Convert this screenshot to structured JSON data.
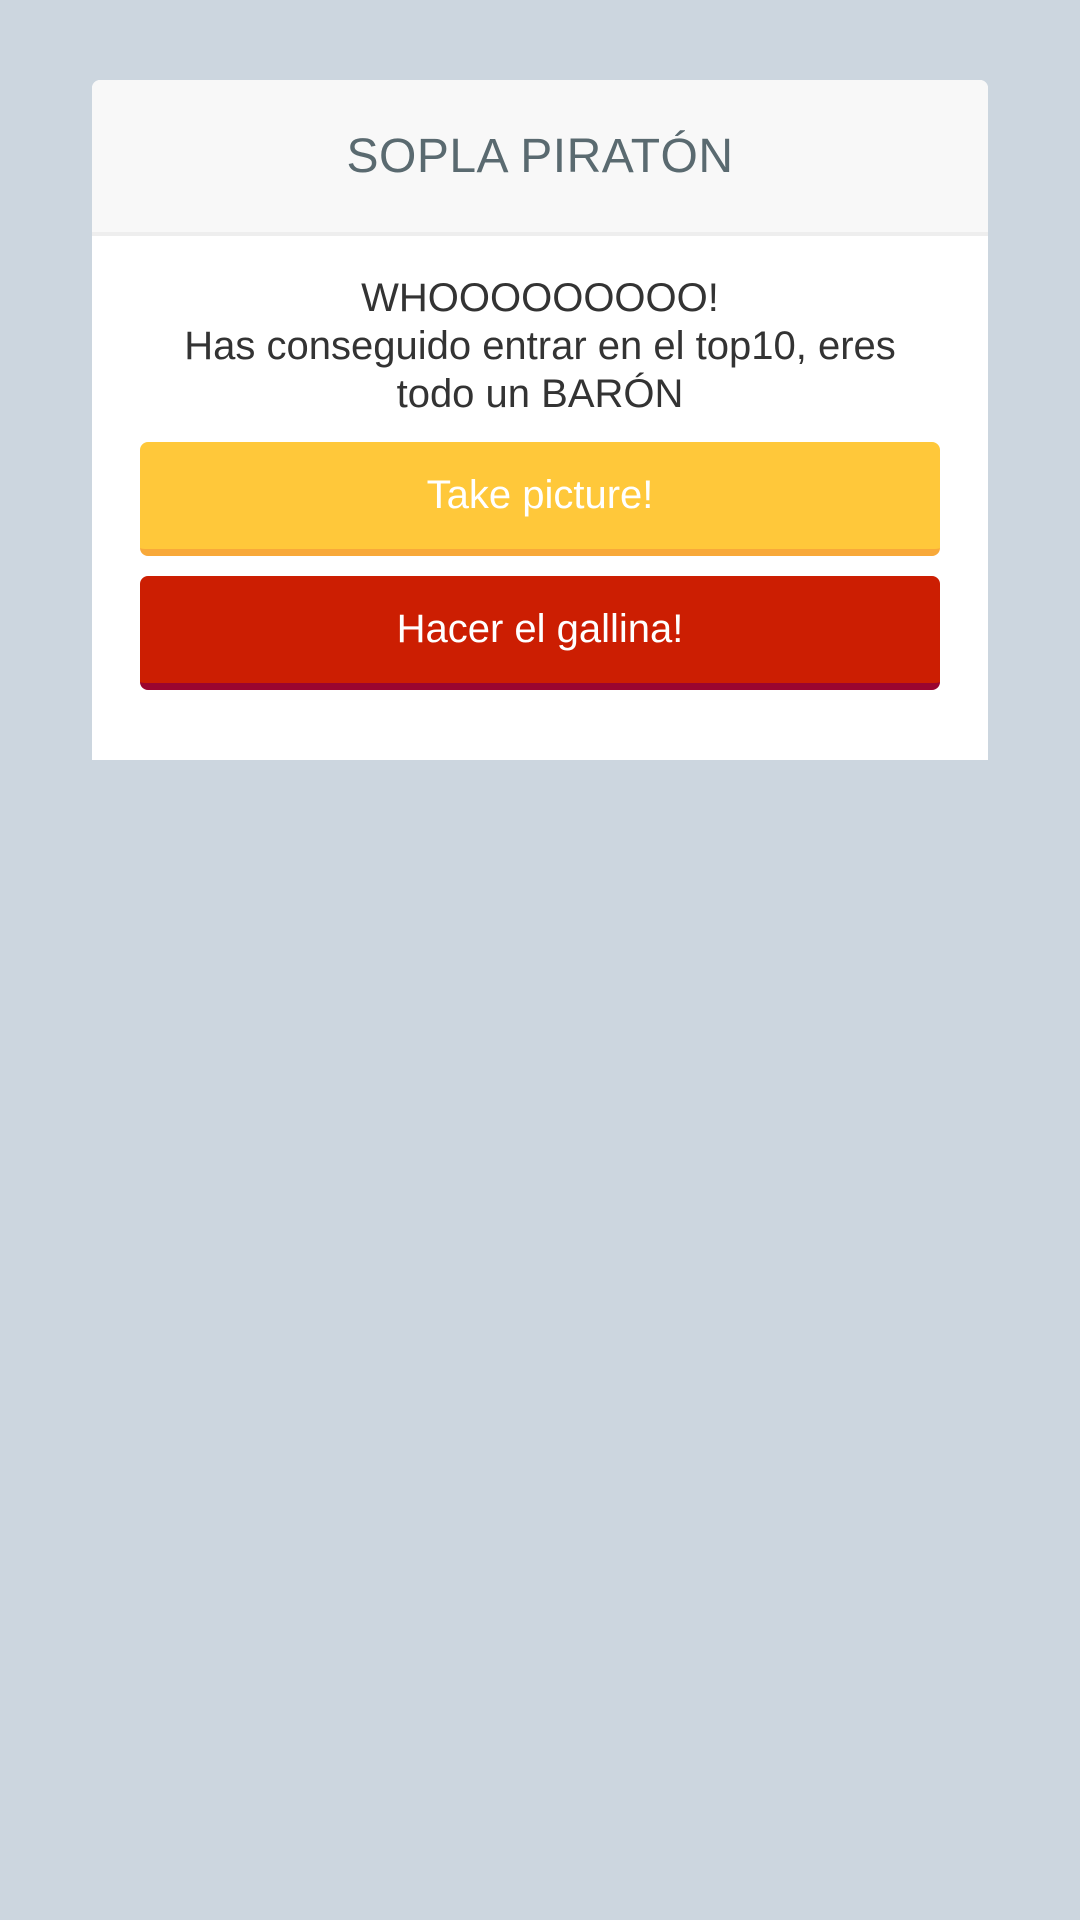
{
  "header": {
    "title": "SOPLA PIRATÓN"
  },
  "message": {
    "line1": "WHOOOOOOOOO!",
    "line2": "Has conseguido entrar en el top10, eres todo un BARÓN"
  },
  "buttons": {
    "take_picture": "Take picture!",
    "chicken_out": "Hacer el gallina!"
  },
  "colors": {
    "background": "#ccd6df",
    "take_picture_button": "#ffc83a",
    "chicken_out_button": "#cc1e02"
  }
}
